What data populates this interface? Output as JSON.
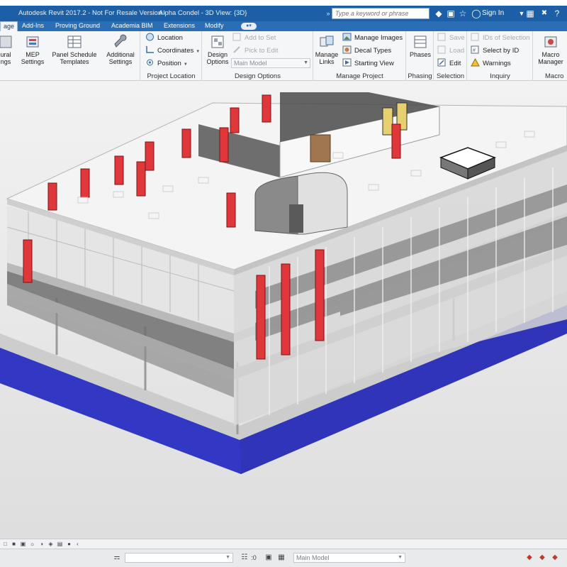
{
  "titlebar": {
    "title": "Autodesk Revit 2017.2 - Not For Resale Version -",
    "document": "Alpha Condel - 3D View: {3D}",
    "search_placeholder": "Type a keyword or phrase",
    "signin": "Sign In",
    "expander_glyph": "»"
  },
  "tabs": [
    {
      "label": "age",
      "active": true
    },
    {
      "label": "Add-Ins"
    },
    {
      "label": "Proving Ground"
    },
    {
      "label": "Academia BIM"
    },
    {
      "label": "Extensions"
    },
    {
      "label": "Modify"
    }
  ],
  "ribbon": {
    "settings": {
      "structural_label": "ural",
      "structural_label_2": "ngs",
      "mep_label": "MEP",
      "mep_label_2": "Settings",
      "panel_schedule_label": "Panel Schedule",
      "panel_schedule_label_2": "Templates",
      "additional_label": "Additional",
      "additional_label_2": "Settings"
    },
    "project_location": {
      "label": "Project Location",
      "location": "Location",
      "coordinates": "Coordinates",
      "position": "Position"
    },
    "design_options": {
      "label": "Design Options",
      "button_label": "Design",
      "button_label_2": "Options",
      "add_to_set": "Add to Set",
      "pick_to_edit": "Pick to Edit",
      "combo_value": "Main Model"
    },
    "manage_project": {
      "label": "Manage Project",
      "manage_links": "Manage",
      "manage_links_2": "Links",
      "manage_images": "Manage Images",
      "decal_types": "Decal Types",
      "starting_view": "Starting View"
    },
    "phasing": {
      "label": "Phasing",
      "phases": "Phases"
    },
    "selection": {
      "label": "Selection",
      "save": "Save",
      "load": "Load",
      "edit": "Edit"
    },
    "inquiry": {
      "label": "Inquiry",
      "ids_of_selection": "IDs of Selection",
      "select_by_id": "Select by ID",
      "warnings": "Warnings"
    },
    "macros": {
      "label": "Macro",
      "macro_manager": "Macro",
      "macro_manager_2": "Manager"
    }
  },
  "statusbar": {
    "active_option": "Main Model",
    "zero_count": ":0"
  },
  "colors": {
    "title_blue": "#1c5fa6",
    "tab_blue": "#2a6fb6",
    "column_red": "#e0383a",
    "base_blue": "#3a3fd0"
  }
}
